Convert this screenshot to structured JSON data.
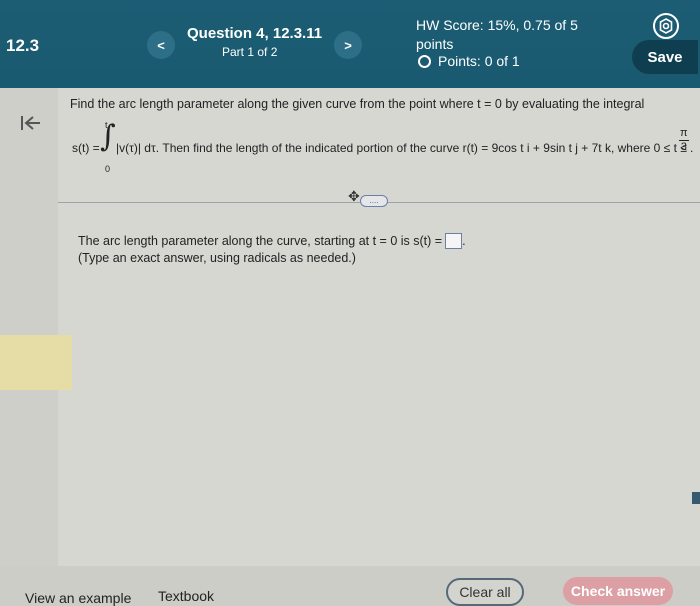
{
  "header": {
    "section": "12.3",
    "question_title": "Question 4, 12.3.11",
    "part": "Part 1 of 2",
    "hw_score": "HW Score: 15%, 0.75 of 5 points",
    "points": "Points: 0 of 1",
    "prev_label": "<",
    "next_label": ">",
    "save_label": "Save"
  },
  "question": {
    "line1": "Find the arc length parameter along the given curve from the point where t = 0 by evaluating the integral",
    "s_lhs": "s(t) =",
    "int_upper": "t",
    "int_lower": "0",
    "integrand_and_text": "|v(τ)| dτ. Then find the length of the indicated portion of the curve r(t) = 9cos t i + 9sin t j + 7t k, where 0 ≤ t ≤",
    "frac_num": "π",
    "frac_den": "3",
    "frac_suffix": ".",
    "more_label": "....",
    "answer_prompt": "The arc length parameter along the curve, starting at t = 0 is s(t) =",
    "answer_suffix": ".",
    "answer_hint": "(Type an exact answer, using radicals as needed.)",
    "answer_value": ""
  },
  "footer": {
    "view_example": "View an example",
    "textbook": "Textbook",
    "clear_all": "Clear all",
    "check_answer": "Check answer"
  },
  "icons": {
    "collapse": "collapse-left-icon",
    "settings": "gear-icon",
    "status": "radio-circle-icon",
    "expand": "move-icon"
  }
}
